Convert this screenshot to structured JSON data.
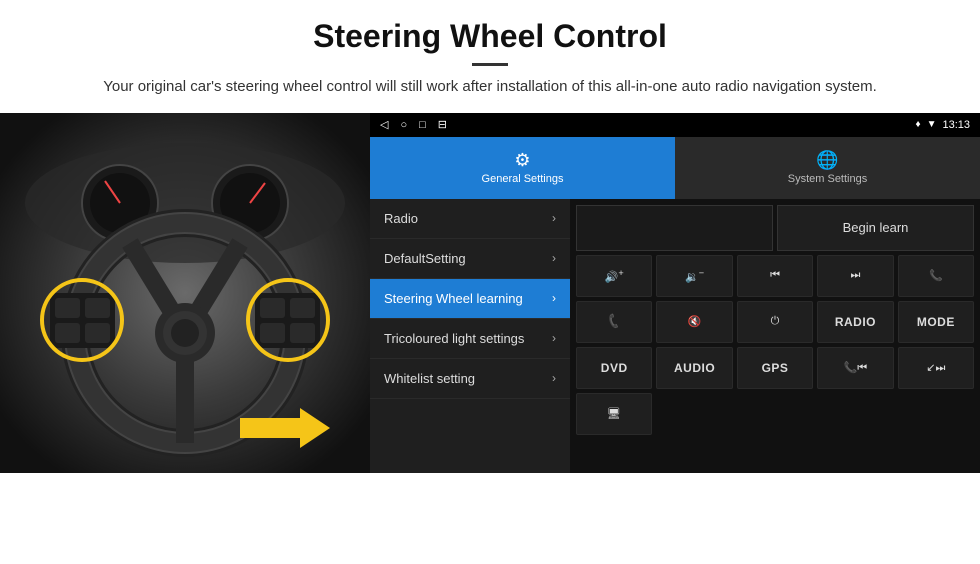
{
  "header": {
    "title": "Steering Wheel Control",
    "description": "Your original car's steering wheel control will still work after installation of this all-in-one auto radio navigation system."
  },
  "android_ui": {
    "status_bar": {
      "time": "13:13",
      "nav_icons": [
        "◁",
        "○",
        "□",
        "⊟"
      ],
      "signal_icons": [
        "♦",
        "▼"
      ]
    },
    "tabs": [
      {
        "id": "general",
        "label": "General Settings",
        "icon": "⚙",
        "active": true
      },
      {
        "id": "system",
        "label": "System Settings",
        "icon": "🌐",
        "active": false
      }
    ],
    "menu_items": [
      {
        "id": "radio",
        "label": "Radio",
        "active": false
      },
      {
        "id": "default",
        "label": "DefaultSetting",
        "active": false
      },
      {
        "id": "steering",
        "label": "Steering Wheel learning",
        "active": true
      },
      {
        "id": "tricoloured",
        "label": "Tricoloured light settings",
        "active": false
      },
      {
        "id": "whitelist",
        "label": "Whitelist setting",
        "active": false
      }
    ],
    "begin_learn_label": "Begin learn",
    "control_buttons": {
      "row1": [
        {
          "id": "vol-up",
          "icon": "🔊+",
          "type": "icon"
        },
        {
          "id": "vol-down",
          "icon": "🔉-",
          "type": "icon"
        },
        {
          "id": "prev-track",
          "icon": "⏮",
          "type": "icon"
        },
        {
          "id": "next-track",
          "icon": "⏭",
          "type": "icon"
        },
        {
          "id": "phone",
          "icon": "📞",
          "type": "icon"
        }
      ],
      "row2": [
        {
          "id": "answer",
          "icon": "📞",
          "type": "icon"
        },
        {
          "id": "mute",
          "icon": "🔇",
          "type": "icon"
        },
        {
          "id": "power",
          "icon": "⏻",
          "type": "icon"
        },
        {
          "id": "radio-btn",
          "label": "RADIO",
          "type": "text"
        },
        {
          "id": "mode-btn",
          "label": "MODE",
          "type": "text"
        }
      ],
      "row3": [
        {
          "id": "dvd-btn",
          "label": "DVD",
          "type": "text"
        },
        {
          "id": "audio-btn",
          "label": "AUDIO",
          "type": "text"
        },
        {
          "id": "gps-btn",
          "label": "GPS",
          "type": "text"
        },
        {
          "id": "tel-prev",
          "icon": "📞⏮",
          "type": "icon"
        },
        {
          "id": "next-mix",
          "icon": "⏭↙",
          "type": "icon"
        }
      ],
      "row4": [
        {
          "id": "usb",
          "icon": "🔌",
          "type": "icon"
        }
      ]
    }
  }
}
